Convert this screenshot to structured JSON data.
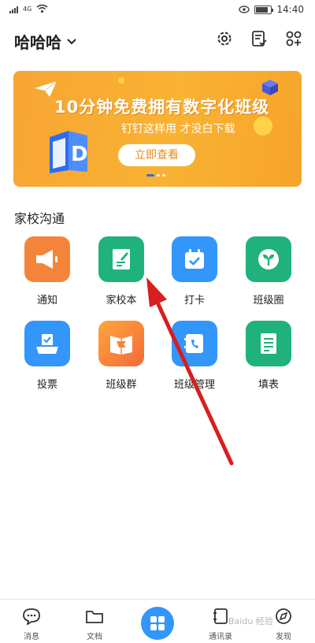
{
  "status_bar": {
    "carrier_mark": "4G",
    "time": "14:40",
    "battery_level": 0.85
  },
  "header": {
    "org_name": "哈哈哈",
    "icons": [
      "settings-icon",
      "checklist-icon",
      "add-apps-icon"
    ]
  },
  "banner": {
    "headline": "10分钟免费拥有数字化班级",
    "subtitle": "钉钉这样用 才没白下载",
    "cta_label": "立即查看",
    "page_count": 3,
    "active_page": 1,
    "colors": {
      "bg": "#f9b233",
      "cta_text": "#e8891a",
      "dot_active": "#3d6be0"
    }
  },
  "section": {
    "title": "家校沟通",
    "apps": [
      {
        "label": "通知",
        "icon": "megaphone-icon",
        "color": "#f5843b"
      },
      {
        "label": "家校本",
        "icon": "notebook-icon",
        "color": "#1fb27c"
      },
      {
        "label": "打卡",
        "icon": "calendar-check-icon",
        "color": "#3296fa"
      },
      {
        "label": "班级圈",
        "icon": "sprout-icon",
        "color": "#1fb27c"
      },
      {
        "label": "投票",
        "icon": "ballot-icon",
        "color": "#3296fa"
      },
      {
        "label": "班级群",
        "icon": "class-group-icon",
        "color": "#f5843b"
      },
      {
        "label": "班级管理",
        "icon": "phonebook-icon",
        "color": "#3296fa"
      },
      {
        "label": "填表",
        "icon": "form-icon",
        "color": "#1fb27c"
      }
    ]
  },
  "bottom_nav": {
    "items": [
      {
        "label": "消息",
        "icon": "chat-icon"
      },
      {
        "label": "文档",
        "icon": "folder-icon"
      },
      {
        "label": "",
        "icon": "workbench-grid-icon"
      },
      {
        "label": "通讯录",
        "icon": "contacts-icon"
      },
      {
        "label": "发现",
        "icon": "discover-icon"
      }
    ]
  },
  "watermark": "Baidu 经验"
}
